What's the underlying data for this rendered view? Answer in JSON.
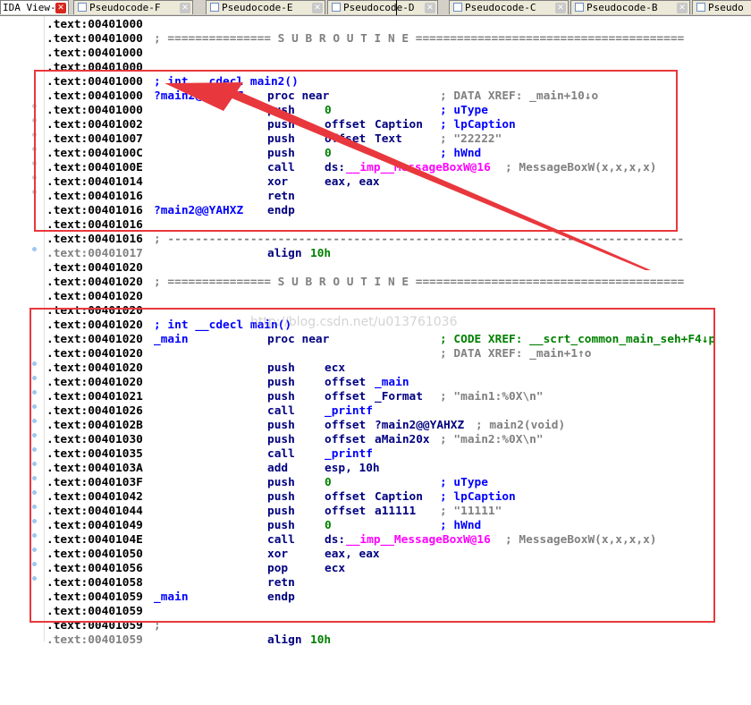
{
  "tabs": [
    {
      "label": "IDA View-A",
      "active": true
    },
    {
      "label": "Pseudocode-F",
      "active": false
    },
    {
      "label": "Pseudocode-E",
      "active": false
    },
    {
      "label": "Pseudocode-D",
      "active": false
    },
    {
      "label": "Pseudocode-C",
      "active": false
    },
    {
      "label": "Pseudocode-B",
      "active": false
    },
    {
      "label": "Pseudo",
      "active": false
    }
  ],
  "code": {
    "addresses": [
      ".text:00401000",
      ".text:00401000",
      ".text:00401000",
      ".text:00401000",
      ".text:00401000",
      ".text:00401000",
      ".text:00401000",
      ".text:00401002",
      ".text:00401007",
      ".text:0040100C",
      ".text:0040100E",
      ".text:00401014",
      ".text:00401016",
      ".text:00401016",
      ".text:00401016",
      ".text:00401016",
      ".text:00401017",
      ".text:00401020",
      ".text:00401020",
      ".text:00401020",
      ".text:00401020",
      ".text:00401020",
      ".text:00401020",
      ".text:00401020",
      ".text:00401020",
      ".text:00401020",
      ".text:00401021",
      ".text:00401026",
      ".text:0040102B",
      ".text:00401030",
      ".text:00401035",
      ".text:0040103A",
      ".text:0040103F",
      ".text:00401042",
      ".text:00401044",
      ".text:00401049",
      ".text:0040104E",
      ".text:00401050",
      ".text:00401056",
      ".text:00401058",
      ".text:00401059",
      ".text:00401059",
      ".text:00401059",
      ".text:00401059",
      ".text:00401059"
    ],
    "subroutine_separator": "; =============== S U B R O U T I N E =======================================",
    "dash_separator": "; ---------------------------------------------------------------------------",
    "main2": {
      "decl": "; int __cdecl main2()",
      "name": "?main2@@YAHXZ",
      "proc": "proc near",
      "xref": "; DATA XREF: _main+10↓o",
      "instructions": [
        {
          "mnem": "push",
          "op1": "0",
          "op2": "",
          "comment": "; uType"
        },
        {
          "mnem": "push",
          "op1": "offset",
          "op2": "Caption",
          "comment": "; lpCaption"
        },
        {
          "mnem": "push",
          "op1": "offset",
          "op2": "Text",
          "comment": "; \"22222\""
        },
        {
          "mnem": "push",
          "op1": "0",
          "op2": "",
          "comment": "; hWnd"
        },
        {
          "mnem": "call",
          "op1": "ds:",
          "op2": "__imp__MessageBoxW@16",
          "comment": "; MessageBoxW(x,x,x,x)"
        },
        {
          "mnem": "xor",
          "op1": "eax, eax",
          "op2": "",
          "comment": ""
        },
        {
          "mnem": "retn",
          "op1": "",
          "op2": "",
          "comment": ""
        }
      ],
      "endp": "endp"
    },
    "align": {
      "mnem": "align",
      "op": "10h"
    },
    "main": {
      "decl": "; int __cdecl main()",
      "name": "_main",
      "proc": "proc near",
      "xref1": "; CODE XREF: __scrt_common_main_seh+F4↓p",
      "xref2": "; DATA XREF: _main+1↑o",
      "instructions": [
        {
          "mnem": "push",
          "op1": "ecx",
          "op2": "",
          "comment": ""
        },
        {
          "mnem": "push",
          "op1": "offset",
          "op2": "_main",
          "comment": ""
        },
        {
          "mnem": "push",
          "op1": "offset",
          "op2": "_Format",
          "comment": "; \"main1:%0X\\n\""
        },
        {
          "mnem": "call",
          "op1": "_printf",
          "op2": "",
          "comment": ""
        },
        {
          "mnem": "push",
          "op1": "offset",
          "op2": "?main2@@YAHXZ",
          "comment": "; main2(void)"
        },
        {
          "mnem": "push",
          "op1": "offset",
          "op2": "aMain20x",
          "comment": "; \"main2:%0X\\n\""
        },
        {
          "mnem": "call",
          "op1": "_printf",
          "op2": "",
          "comment": ""
        },
        {
          "mnem": "add",
          "op1": "esp, 10h",
          "op2": "",
          "comment": ""
        },
        {
          "mnem": "push",
          "op1": "0",
          "op2": "",
          "comment": "; uType"
        },
        {
          "mnem": "push",
          "op1": "offset",
          "op2": "Caption",
          "comment": "; lpCaption"
        },
        {
          "mnem": "push",
          "op1": "offset",
          "op2": "a11111",
          "comment": "; \"11111\""
        },
        {
          "mnem": "push",
          "op1": "0",
          "op2": "",
          "comment": "; hWnd"
        },
        {
          "mnem": "call",
          "op1": "ds:",
          "op2": "__imp__MessageBoxW@16",
          "comment": "; MessageBoxW(x,x,x,x)"
        },
        {
          "mnem": "xor",
          "op1": "eax, eax",
          "op2": "",
          "comment": ""
        },
        {
          "mnem": "pop",
          "op1": "ecx",
          "op2": "",
          "comment": ""
        },
        {
          "mnem": "retn",
          "op1": "",
          "op2": "",
          "comment": ""
        }
      ],
      "endp": "endp"
    },
    "tail_sep": ";",
    "watermark": "http://blog.csdn.net/u013761036"
  },
  "colors": {
    "annotation_red": "#e8383d",
    "name_blue": "#0000ff",
    "mnemonic_navy": "#000080",
    "import_magenta": "#ff00ff"
  }
}
